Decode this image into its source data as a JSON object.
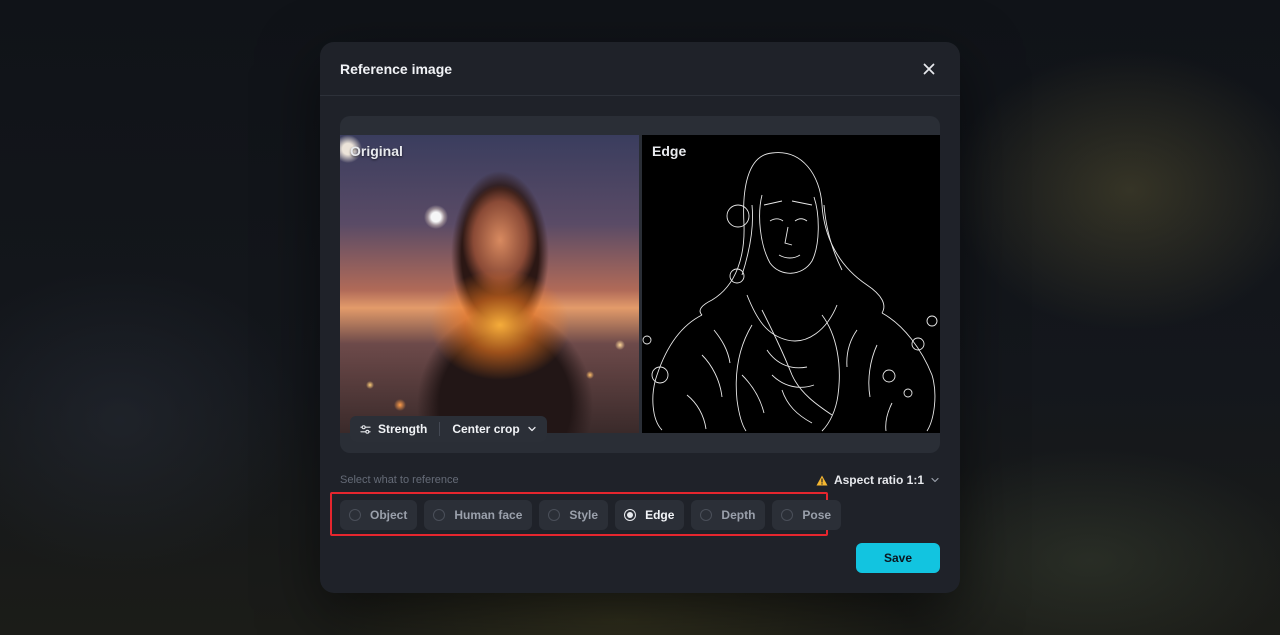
{
  "dialog": {
    "title": "Reference image",
    "close_icon": "close-icon"
  },
  "preview": {
    "original_label": "Original",
    "processed_label": "Edge"
  },
  "toolbar": {
    "strength_label": "Strength",
    "crop_label": "Center crop"
  },
  "reference": {
    "label": "Select what to reference",
    "aspect_ratio": "Aspect ratio 1:1",
    "options": [
      {
        "label": "Object",
        "selected": false
      },
      {
        "label": "Human face",
        "selected": false
      },
      {
        "label": "Style",
        "selected": false
      },
      {
        "label": "Edge",
        "selected": true
      },
      {
        "label": "Depth",
        "selected": false
      },
      {
        "label": "Pose",
        "selected": false
      }
    ]
  },
  "actions": {
    "save_label": "Save"
  },
  "colors": {
    "accent": "#12c4e0",
    "highlight_frame": "#e5262e",
    "warning": "#f5b731"
  }
}
